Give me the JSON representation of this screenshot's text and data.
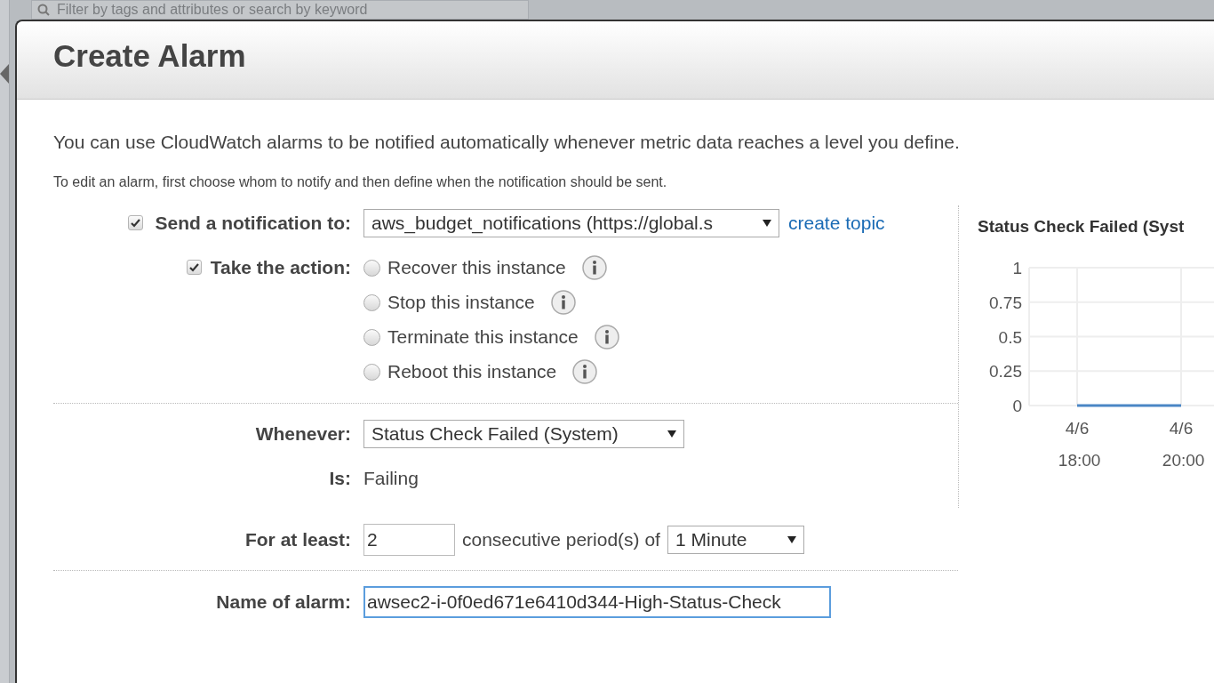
{
  "background": {
    "filter_placeholder": "Filter by tags and attributes or search by keyword"
  },
  "dialog": {
    "title": "Create Alarm",
    "intro": "You can use CloudWatch alarms to be notified automatically whenever metric data reaches a level you define.",
    "hint": "To edit an alarm, first choose whom to notify and then define when the notification should be sent."
  },
  "notification": {
    "checked": true,
    "label": "Send a notification to:",
    "value": "aws_budget_notifications (https://global.s",
    "link": "create topic"
  },
  "action": {
    "checked": true,
    "label": "Take the action:",
    "options": [
      {
        "label": "Recover this instance",
        "selected": false
      },
      {
        "label": "Stop this instance",
        "selected": false
      },
      {
        "label": "Terminate this instance",
        "selected": false
      },
      {
        "label": "Reboot this instance",
        "selected": false
      }
    ]
  },
  "whenever": {
    "label": "Whenever:",
    "value": "Status Check Failed (System)"
  },
  "is": {
    "label": "Is:",
    "value": "Failing"
  },
  "for_at_least": {
    "label": "For at least:",
    "value": "2",
    "text": "consecutive period(s) of",
    "period": "1 Minute"
  },
  "alarm_name": {
    "label": "Name of alarm:",
    "value": "awsec2-i-0f0ed671e6410d344-High-Status-Check"
  },
  "chart": {
    "chart_data": {
      "type": "line",
      "title": "Status Check Failed (Syst",
      "categories": [
        "4/6\n18:00",
        "4/6\n20:00"
      ],
      "series": [
        {
          "color": "#4a86c5",
          "values": [
            0,
            0
          ]
        }
      ],
      "grid": true,
      "ylim": [
        0,
        1
      ],
      "yticks": [
        {
          "value": 1,
          "label": "1"
        },
        {
          "value": 0.75,
          "label": "0.75"
        },
        {
          "value": 0.5,
          "label": "0.5"
        },
        {
          "value": 0.25,
          "label": "0.25"
        },
        {
          "value": 0,
          "label": "0"
        }
      ]
    }
  }
}
